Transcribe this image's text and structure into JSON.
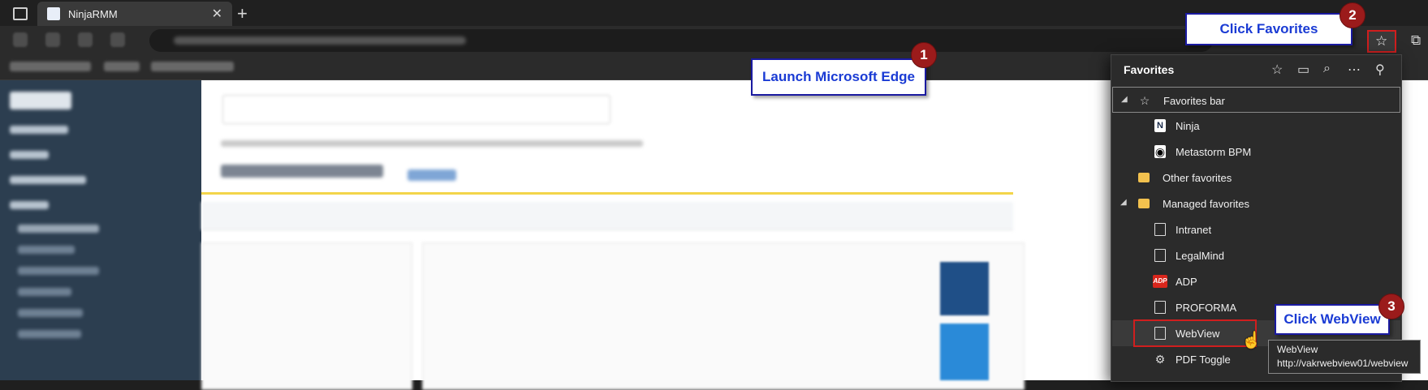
{
  "browser": {
    "tab_title": "NinjaRMM",
    "new_tab_label": "+",
    "close_tab_label": "✕"
  },
  "favorites_panel": {
    "title": "Favorites",
    "items": [
      {
        "label": "Favorites bar",
        "icon": "star-outline-icon",
        "level": 0,
        "expanded": true
      },
      {
        "label": "Ninja",
        "icon": "ninja-favicon",
        "level": 1
      },
      {
        "label": "Metastorm BPM",
        "icon": "eye-favicon",
        "level": 1
      },
      {
        "label": "Other favorites",
        "icon": "folder-icon",
        "level": 0
      },
      {
        "label": "Managed favorites",
        "icon": "managed-folder-icon",
        "level": 0,
        "expanded": true
      },
      {
        "label": "Intranet",
        "icon": "page-icon",
        "level": 1
      },
      {
        "label": "LegalMind",
        "icon": "page-icon",
        "level": 1
      },
      {
        "label": "ADP",
        "icon": "adp-favicon",
        "level": 1
      },
      {
        "label": "PROFORMA",
        "icon": "page-icon",
        "level": 1
      },
      {
        "label": "WebView",
        "icon": "page-icon",
        "level": 1,
        "highlighted": true
      },
      {
        "label": "PDF Toggle",
        "icon": "gear-icon",
        "level": 1
      }
    ]
  },
  "tooltip": {
    "title": "WebView",
    "url": "http://vakrwebview01/webview"
  },
  "callouts": {
    "step1": {
      "number": "1",
      "text": "Launch Microsoft Edge"
    },
    "step2": {
      "number": "2",
      "text": "Click Favorites"
    },
    "step3": {
      "number": "3",
      "text": "Click WebView"
    }
  },
  "colors": {
    "annotation_red": "#d01e1e",
    "callout_text": "#1a3bd4",
    "badge": "#9b1b1b",
    "panel_bg": "#2b2b2b"
  }
}
